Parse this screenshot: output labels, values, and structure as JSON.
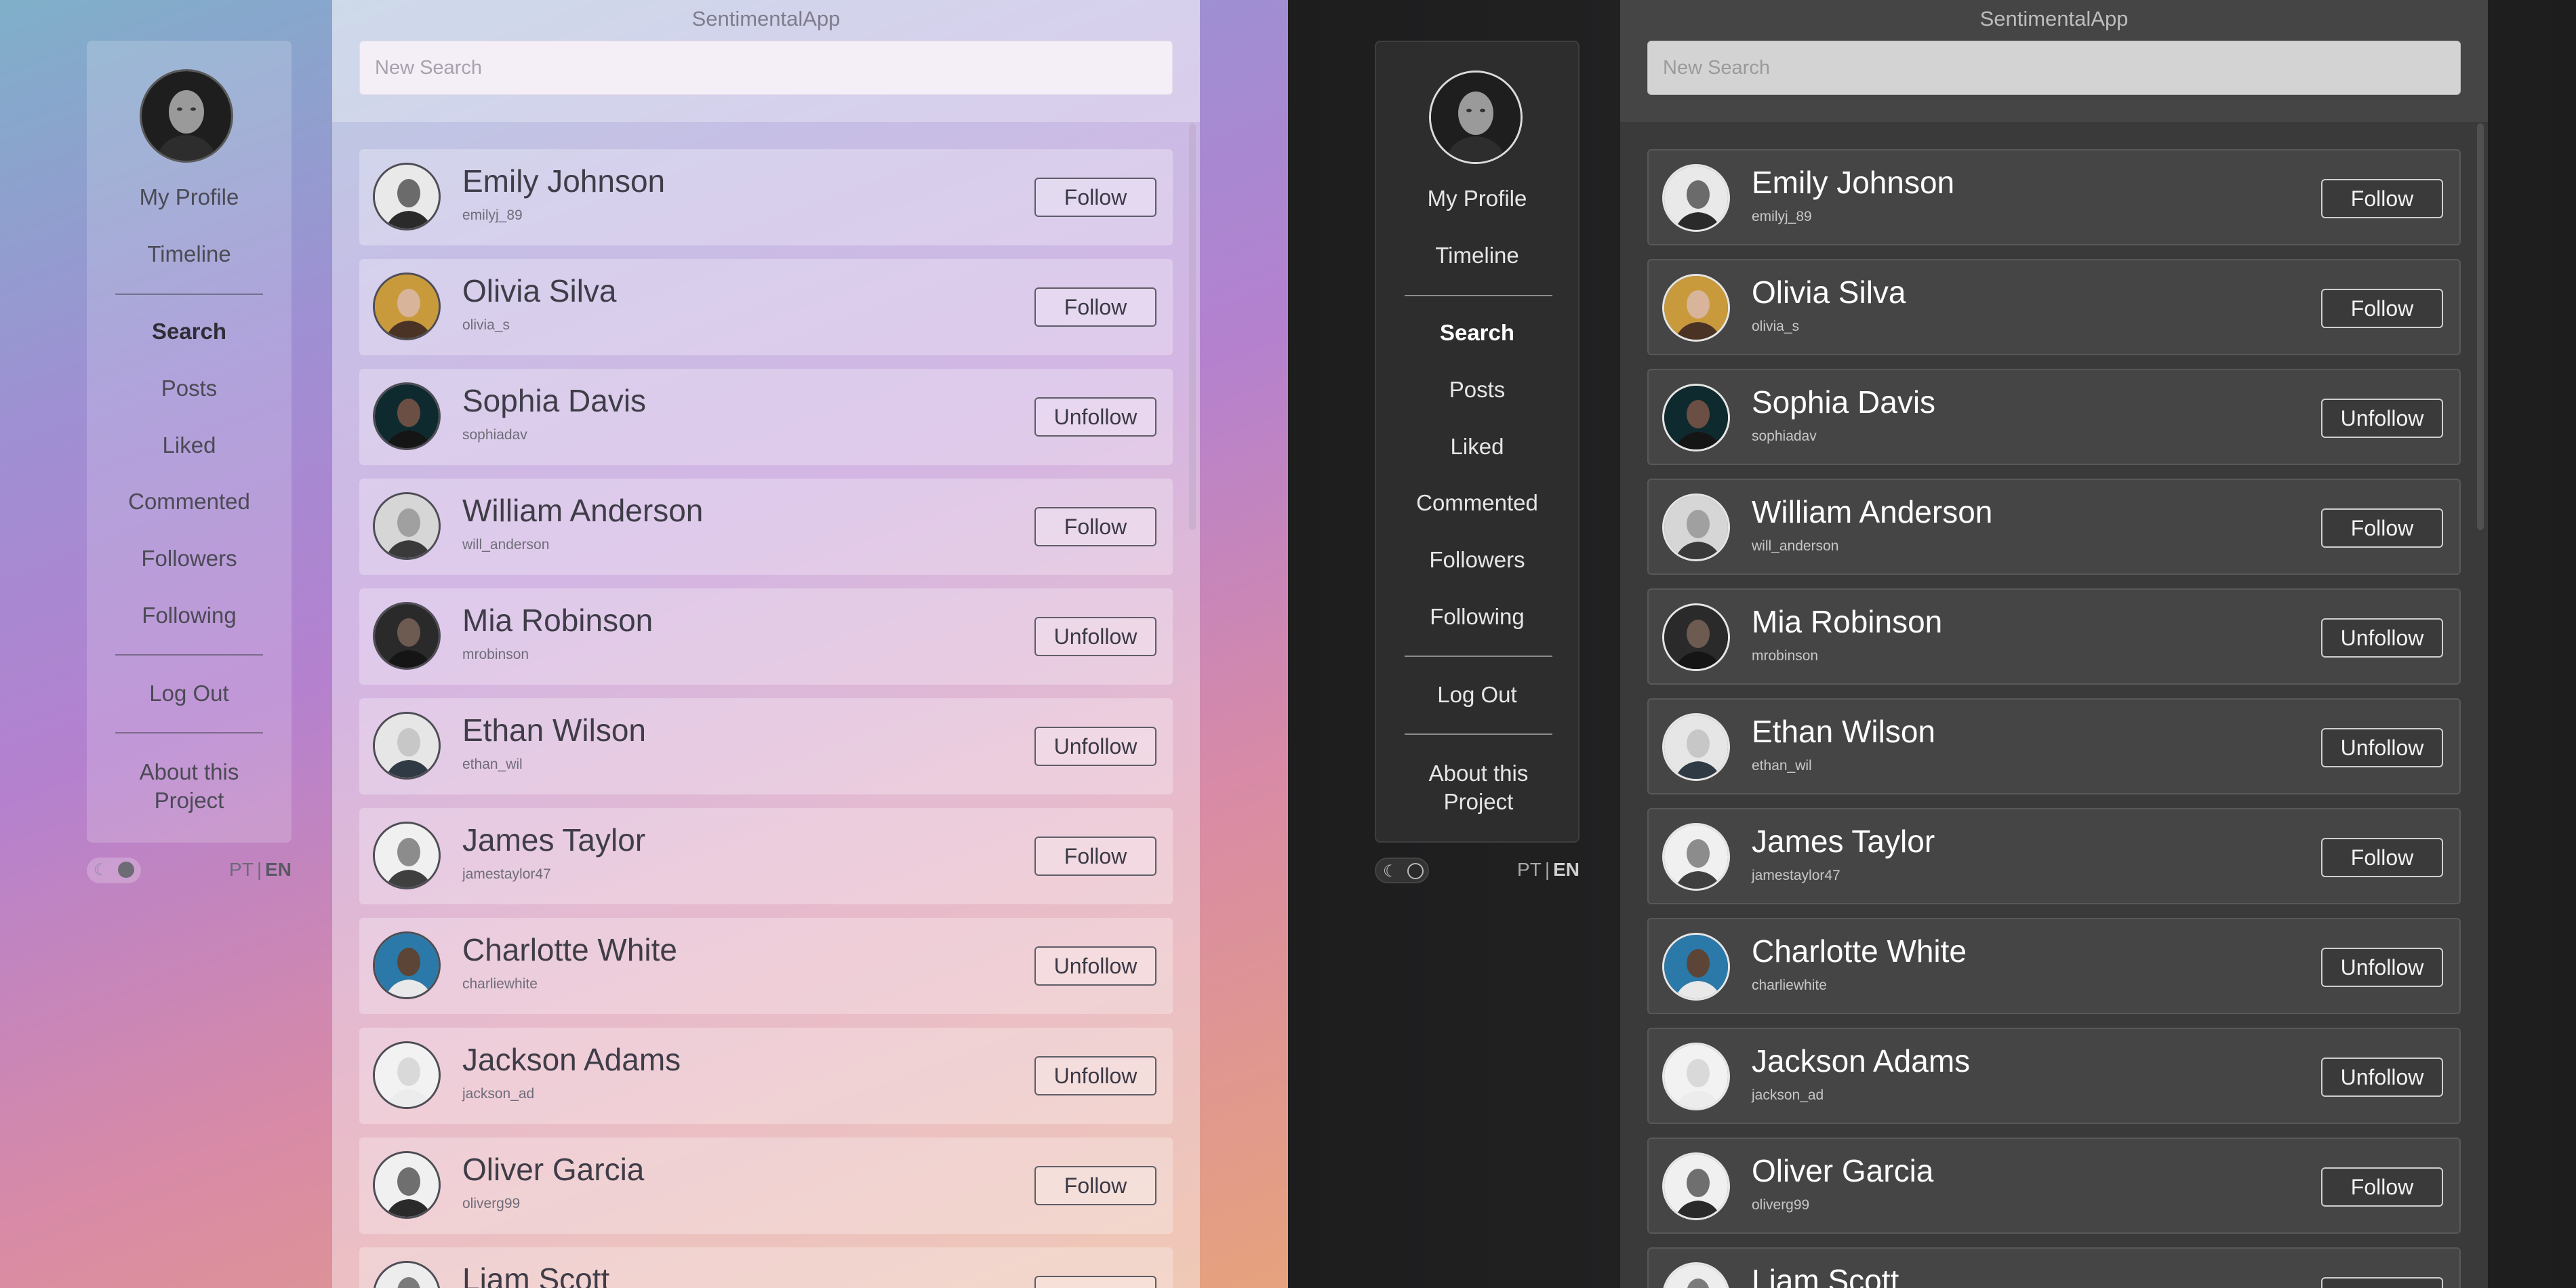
{
  "app": {
    "title": "SentimentalApp"
  },
  "search": {
    "placeholder": "New Search",
    "value": ""
  },
  "nav": {
    "my_profile": "My Profile",
    "timeline": "Timeline",
    "search": "Search",
    "posts": "Posts",
    "liked": "Liked",
    "commented": "Commented",
    "followers": "Followers",
    "following": "Following",
    "logout": "Log Out",
    "about": "About this Project"
  },
  "lang": {
    "pt": "PT",
    "sep": "|",
    "en": "EN"
  },
  "users": [
    {
      "name": "Emily Johnson",
      "handle": "emilyj_89",
      "action": "Follow"
    },
    {
      "name": "Olivia Silva",
      "handle": "olivia_s",
      "action": "Follow"
    },
    {
      "name": "Sophia Davis",
      "handle": "sophiadav",
      "action": "Unfollow"
    },
    {
      "name": "William Anderson",
      "handle": "will_anderson",
      "action": "Follow"
    },
    {
      "name": "Mia Robinson",
      "handle": "mrobinson",
      "action": "Unfollow"
    },
    {
      "name": "Ethan Wilson",
      "handle": "ethan_wil",
      "action": "Unfollow"
    },
    {
      "name": "James Taylor",
      "handle": "jamestaylor47",
      "action": "Follow"
    },
    {
      "name": "Charlotte White",
      "handle": "charliewhite",
      "action": "Unfollow"
    },
    {
      "name": "Jackson Adams",
      "handle": "jackson_ad",
      "action": "Unfollow"
    },
    {
      "name": "Oliver Garcia",
      "handle": "oliverg99",
      "action": "Follow"
    },
    {
      "name": "Liam Scott",
      "handle": "",
      "action": ""
    }
  ],
  "themes": [
    "light",
    "dark"
  ]
}
